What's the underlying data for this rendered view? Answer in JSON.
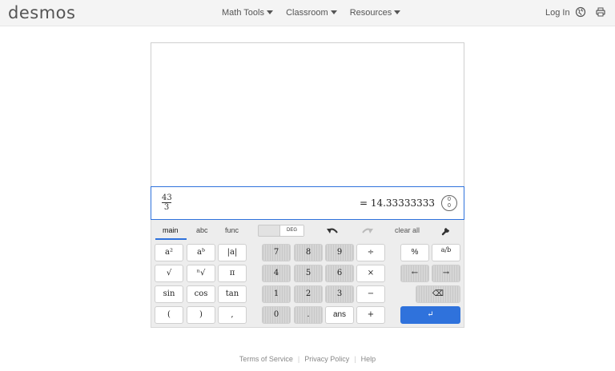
{
  "header": {
    "logo": "desmos",
    "nav": [
      "Math Tools",
      "Classroom",
      "Resources"
    ],
    "login": "Log In"
  },
  "expression": {
    "numerator": "43",
    "denominator": "3",
    "result": "= 14.33333333"
  },
  "format_button": {
    "top": "0",
    "bottom": "0"
  },
  "keypad": {
    "tabs": [
      "main",
      "abc",
      "func"
    ],
    "active_tab": "main",
    "angle_mode": "DEG",
    "clear_all": "clear all",
    "keys": {
      "square": "a²",
      "power": "aᵇ",
      "abs": "|a|",
      "sqrt": "√",
      "nthroot": "ⁿ√",
      "pi": "π",
      "sin": "sin",
      "cos": "cos",
      "tan": "tan",
      "lparen": "(",
      "rparen": ")",
      "comma": ",",
      "d7": "7",
      "d8": "8",
      "d9": "9",
      "div": "÷",
      "d4": "4",
      "d5": "5",
      "d6": "6",
      "mul": "×",
      "d1": "1",
      "d2": "2",
      "d3": "3",
      "minus": "−",
      "d0": "0",
      "dot": ".",
      "ans": "ans",
      "plus": "+",
      "percent": "%",
      "fraction": "a/b",
      "left": "←",
      "right": "→",
      "backspace": "⌫",
      "enter": "↵"
    }
  },
  "footer": [
    "Terms of Service",
    "Privacy Policy",
    "Help"
  ],
  "colors": {
    "accent": "#2f72dc",
    "topbar": "#f4f4f4",
    "keypad": "#ededed"
  }
}
